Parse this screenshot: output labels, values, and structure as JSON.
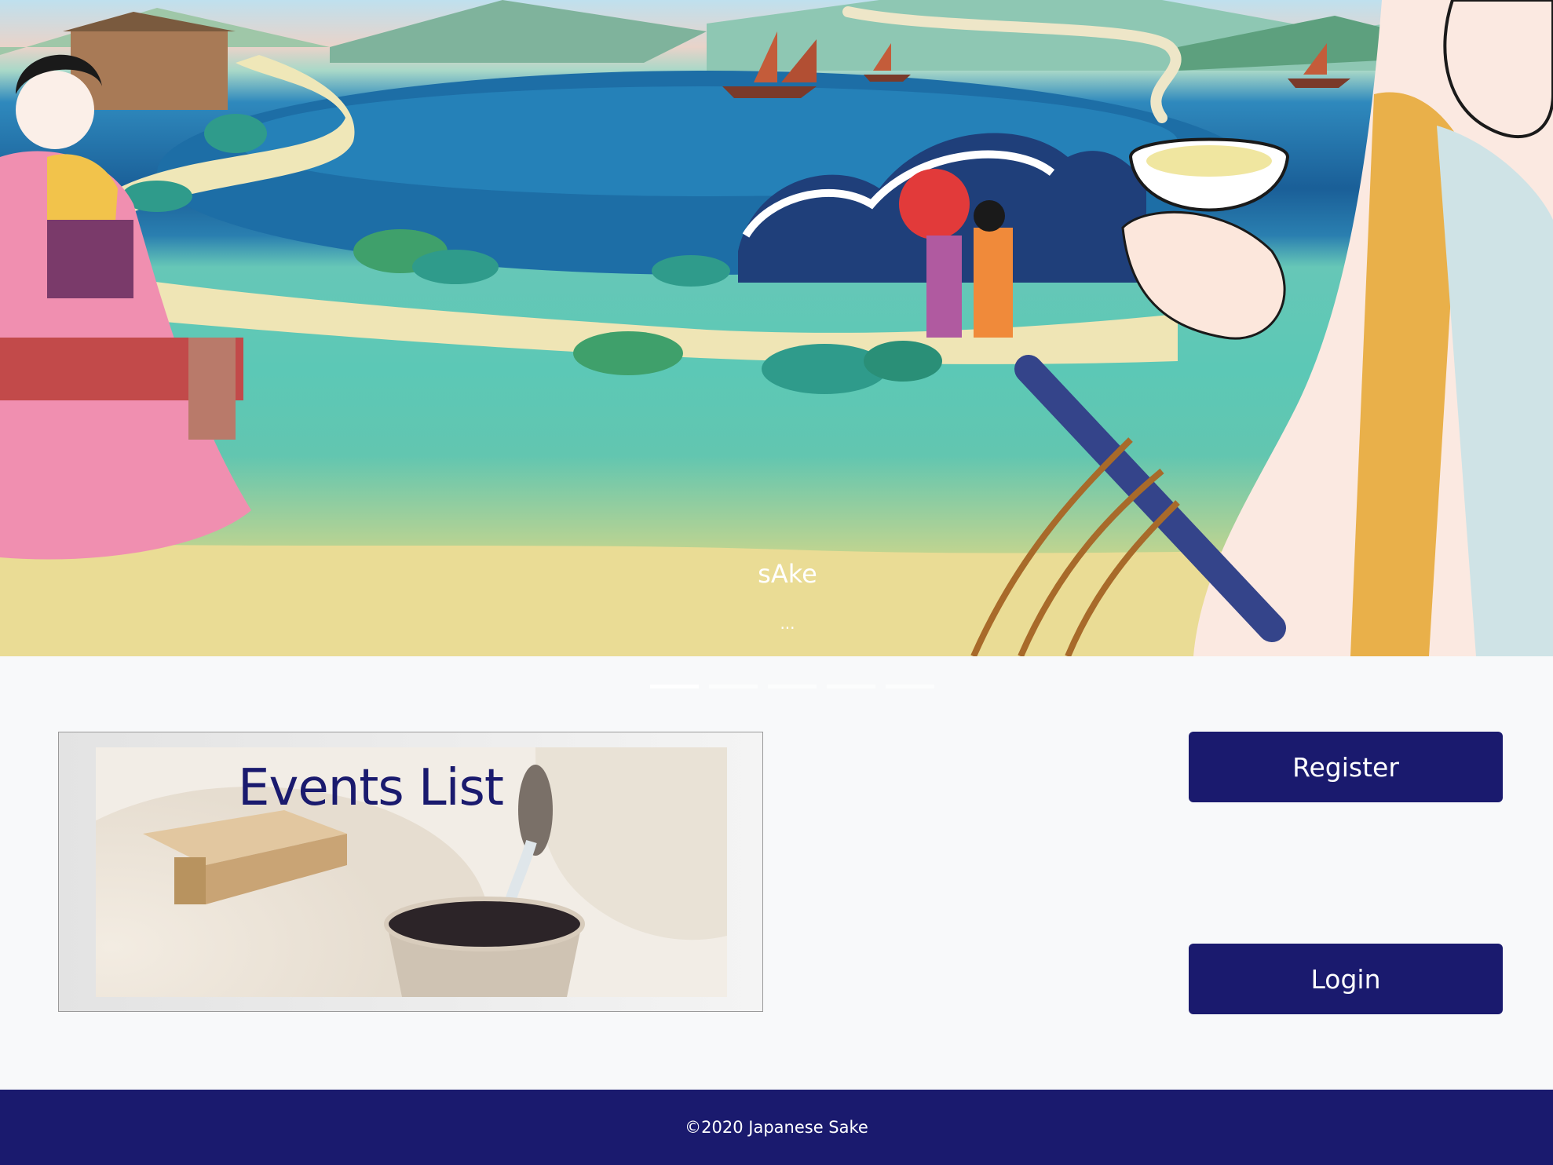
{
  "carousel": {
    "caption_title": "sAke",
    "caption_text": "...",
    "indicators": 5,
    "active_index": 0
  },
  "events": {
    "title": "Events List"
  },
  "buttons": {
    "register_label": "Register",
    "login_label": "Login"
  },
  "footer": {
    "copyright": "©2020 Japanese Sake"
  },
  "colors": {
    "primary": "#1a1a6e",
    "background": "#f8f9fa"
  }
}
